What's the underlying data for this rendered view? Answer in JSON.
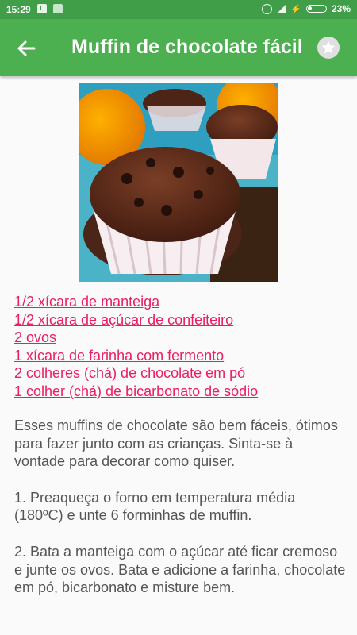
{
  "status_bar": {
    "time": "15:29",
    "battery_pct": "23%",
    "battery_level": 0.23,
    "icons": [
      "download-icon",
      "app-notification-icon",
      "alarm-icon",
      "signal-icon",
      "charging-icon",
      "battery-icon"
    ]
  },
  "app_bar": {
    "title": "Muffin de chocolate fácil",
    "back_icon": "arrow-left-icon",
    "favorite_icon": "star-icon",
    "color": "#4caf50"
  },
  "ingredients": [
    "1/2 xícara de manteiga",
    "1/2 xícara de açúcar de confeiteiro",
    "2 ovos",
    "1 xícara de farinha com fermento",
    "2 colheres (chá) de chocolate em pó",
    "1 colher (chá) de bicarbonato de sódio"
  ],
  "description": [
    "Esses muffins de chocolate são bem fáceis, ótimos para fazer junto com as crianças. Sinta-se à vontade para decorar como quiser.",
    "1. Preaqueça o forno em temperatura média (180ºC) e unte 6 forminhas de muffin.",
    "2. Bata a manteiga com o açúcar até ficar cremoso e junte os ovos. Bata e adicione a farinha, chocolate em pó, bicarbonato e misture bem."
  ],
  "link_color": "#e91e63"
}
